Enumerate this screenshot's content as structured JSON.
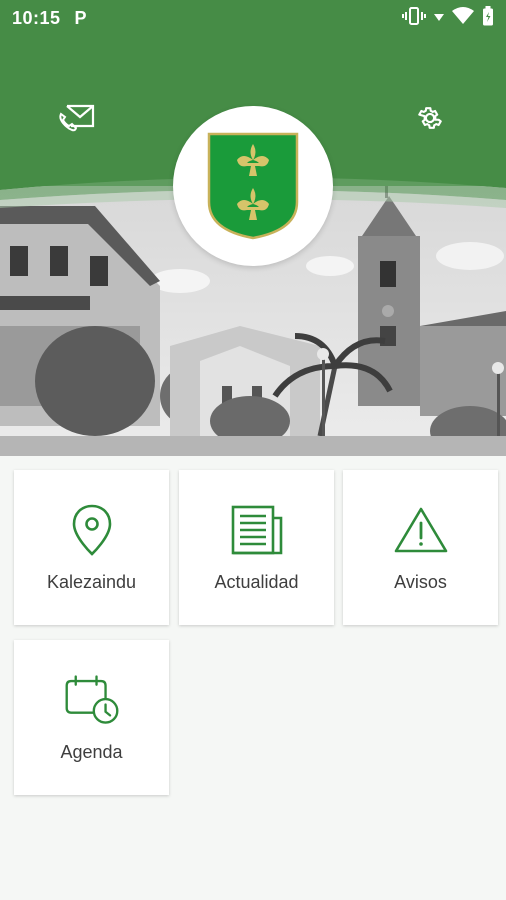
{
  "status_bar": {
    "time": "10:15",
    "app_badge": "P",
    "icons": [
      "vibrate-icon",
      "signal-icon",
      "wifi-icon",
      "battery-icon"
    ]
  },
  "header": {
    "left_icon": "mail-phone-icon",
    "right_icon": "gear-icon",
    "emblem": "coat-of-arms-fleur-de-lis"
  },
  "colors": {
    "primary": "#468c46",
    "emblem_green": "#1a9b3a",
    "emblem_gold": "#c8b25a",
    "card_bg": "#ffffff",
    "page_bg": "#f5f7f5"
  },
  "menu": {
    "items": [
      {
        "label": "Kalezaindu",
        "icon": "location-pin-icon"
      },
      {
        "label": "Actualidad",
        "icon": "newspaper-icon"
      },
      {
        "label": "Avisos",
        "icon": "warning-icon"
      },
      {
        "label": "Agenda",
        "icon": "calendar-clock-icon"
      }
    ]
  }
}
